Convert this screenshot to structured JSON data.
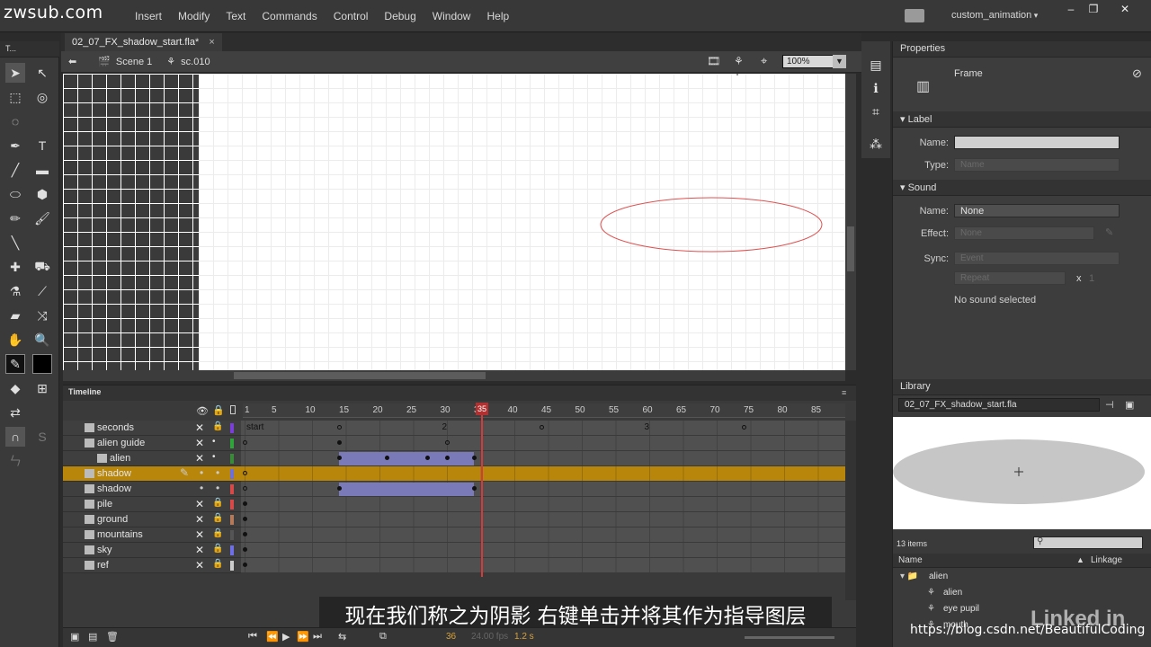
{
  "watermark_site": "zwsub.com",
  "menu": [
    "Insert",
    "Modify",
    "Text",
    "Commands",
    "Control",
    "Debug",
    "Window",
    "Help"
  ],
  "workspace": "custom_animation",
  "window_buttons": [
    "–",
    "❐",
    "✕"
  ],
  "tools_title": "T...",
  "document": {
    "tab_label": "02_07_FX_shadow_start.fla*",
    "tab_close": "×",
    "scene": "Scene 1",
    "symbol": "sc.010",
    "zoom": "100%"
  },
  "properties": {
    "title": "Properties",
    "type": "Frame",
    "label_section": "Label",
    "name_label": "Name:",
    "type_label": "Type:",
    "type_value": "Name",
    "sound_section": "Sound",
    "sound_name_label": "Name:",
    "sound_name_value": "None",
    "effect_label": "Effect:",
    "effect_value": "None",
    "sync_label": "Sync:",
    "sync_value": "Event",
    "repeat_value": "Repeat",
    "repeat_x": "x",
    "repeat_count": "1",
    "no_sound": "No sound selected"
  },
  "timeline": {
    "title": "Timeline",
    "ruler": [
      "1",
      "5",
      "10",
      "15",
      "20",
      "25",
      "30",
      "35",
      "40",
      "45",
      "50",
      "55",
      "60",
      "65",
      "70",
      "75",
      "80",
      "85"
    ],
    "playhead_frame": "35",
    "frame_labels": [
      "start",
      "2",
      "3"
    ],
    "layers": [
      {
        "name": "seconds",
        "color": "#7a3fd8",
        "locked": true,
        "selected": false
      },
      {
        "name": "alien guide",
        "color": "#2ea43a",
        "locked": false,
        "selected": false
      },
      {
        "name": "alien",
        "color": "#3a8a3a",
        "locked": false,
        "selected": false
      },
      {
        "name": "shadow",
        "color": "#6f6fd8",
        "locked": false,
        "selected": true
      },
      {
        "name": "shadow",
        "color": "#d84a4a",
        "locked": false,
        "selected": false
      },
      {
        "name": "pile",
        "color": "#d84a4a",
        "locked": true,
        "selected": false
      },
      {
        "name": "ground",
        "color": "#b57a5a",
        "locked": true,
        "selected": false
      },
      {
        "name": "mountains",
        "color": "#555555",
        "locked": true,
        "selected": false
      },
      {
        "name": "sky",
        "color": "#6f6fe8",
        "locked": true,
        "selected": false
      },
      {
        "name": "ref",
        "color": "#cccccc",
        "locked": true,
        "selected": false
      }
    ],
    "current_frame": "36",
    "fps": "24.00 fps",
    "time": "1.2 s"
  },
  "library": {
    "title": "Library",
    "file": "02_07_FX_shadow_start.fla",
    "count": "13 items",
    "col_name": "Name",
    "col_linkage": "Linkage",
    "items": [
      {
        "name": "alien",
        "type": "folder"
      },
      {
        "name": "alien",
        "type": "symbol"
      },
      {
        "name": "eye pupil",
        "type": "symbol"
      },
      {
        "name": "mouth",
        "type": "symbol"
      }
    ]
  },
  "subtitle": "现在我们称之为阴影  右键单击并将其作为指导图层",
  "watermark_url": "https://blog.csdn.net/BeautifulCoding",
  "watermark_brand": "Linked in"
}
